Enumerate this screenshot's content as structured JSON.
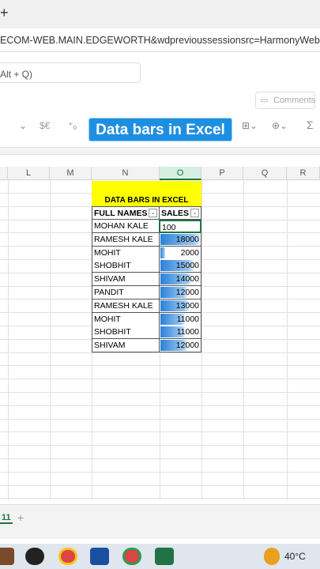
{
  "browser": {
    "new_tab": "+",
    "url": "ECOM-WEB.MAIN.EDGEWORTH&wdprevioussessionsrc=HarmonyWeb&wdpre",
    "search_placeholder": "Alt + Q)"
  },
  "toolbar": {
    "comments_label": "Comments",
    "currency_icon": "$€",
    "wrap_icon": "⊕"
  },
  "overlay_title": "Data bars in Excel",
  "columns": [
    "L",
    "M",
    "N",
    "O",
    "P",
    "Q",
    "R"
  ],
  "selected_column": "O",
  "table": {
    "title": "DATA BARS IN EXCEL",
    "headers": {
      "name": "FULL NAMES",
      "sales": "SALES"
    },
    "rows": [
      {
        "name": "MOHAN KALE",
        "sales": "100",
        "fraction": 0.0
      },
      {
        "name": "RAMESH KALE",
        "sales": "18000",
        "fraction": 1.0
      },
      {
        "name": "MOHIT",
        "sales": "2000",
        "fraction": 0.11
      },
      {
        "name": "SHOBHIT",
        "sales": "15000",
        "fraction": 0.83
      },
      {
        "name": "SHIVAM",
        "sales": "14000",
        "fraction": 0.78
      },
      {
        "name": "PANDIT",
        "sales": "12000",
        "fraction": 0.67
      },
      {
        "name": "RAMESH KALE",
        "sales": "13000",
        "fraction": 0.72
      },
      {
        "name": "MOHIT",
        "sales": "11000",
        "fraction": 0.61
      },
      {
        "name": "SHOBHIT",
        "sales": "11000",
        "fraction": 0.61
      },
      {
        "name": "SHIVAM",
        "sales": "12000",
        "fraction": 0.67
      }
    ]
  },
  "sheet_tab": "11",
  "sheet_add": "+",
  "taskbar": {
    "temperature": "40°C"
  }
}
